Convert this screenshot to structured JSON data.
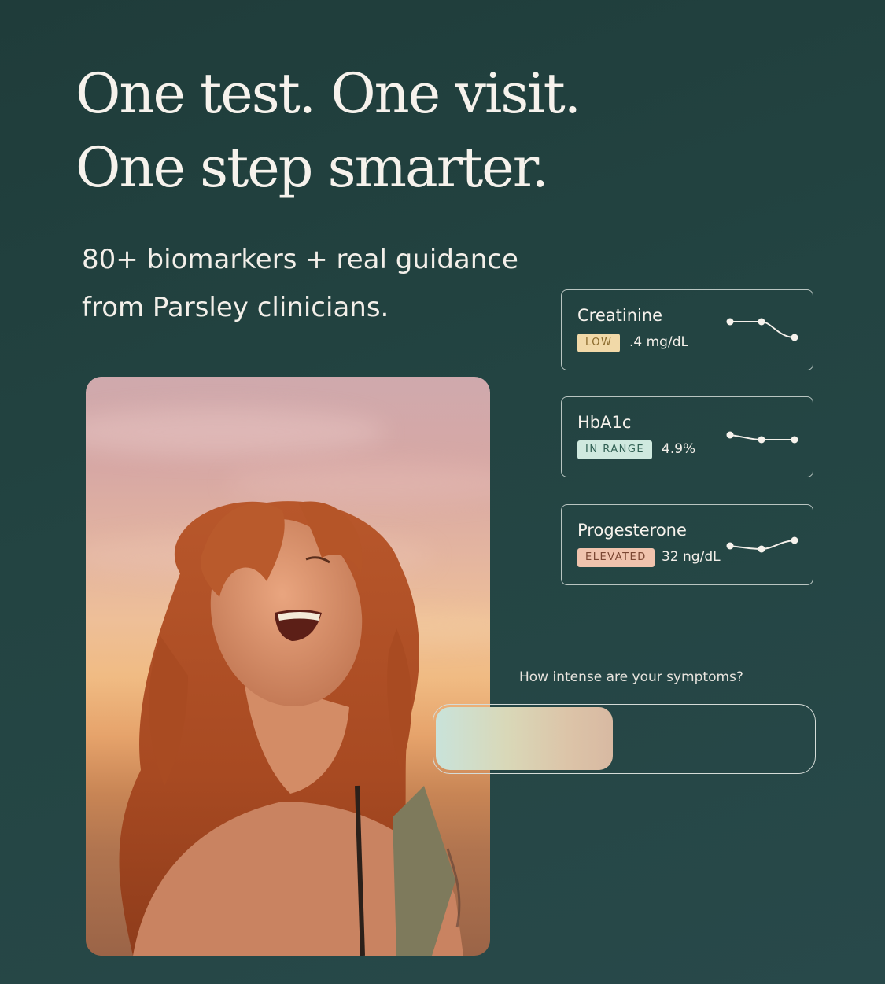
{
  "headline": {
    "line1": "One test. One visit.",
    "line2": "One step smarter."
  },
  "subhead": {
    "line1": "80+ biomarkers + real guidance",
    "line2": "from Parsley clinicians."
  },
  "biomarkers": [
    {
      "name": "Creatinine",
      "status": "LOW",
      "value": ".4 mg/dL",
      "status_bg": "#f1d9a8",
      "status_fg": "#8a6a2c",
      "trend": "down"
    },
    {
      "name": "HbA1c",
      "status": "IN RANGE",
      "value": "4.9%",
      "status_bg": "#cfe9df",
      "status_fg": "#2f5f52",
      "trend": "flat"
    },
    {
      "name": "Progesterone",
      "status": "ELEVATED",
      "value": "32 ng/dL",
      "status_bg": "#f0c3ad",
      "status_fg": "#7a4632",
      "trend": "up"
    }
  ],
  "symptoms": {
    "question": "How intense are your symptoms?",
    "level_fraction": 0.47
  },
  "colors": {
    "background": "#234442",
    "text": "#f3efe9",
    "card_border": "#b9c5c1"
  }
}
